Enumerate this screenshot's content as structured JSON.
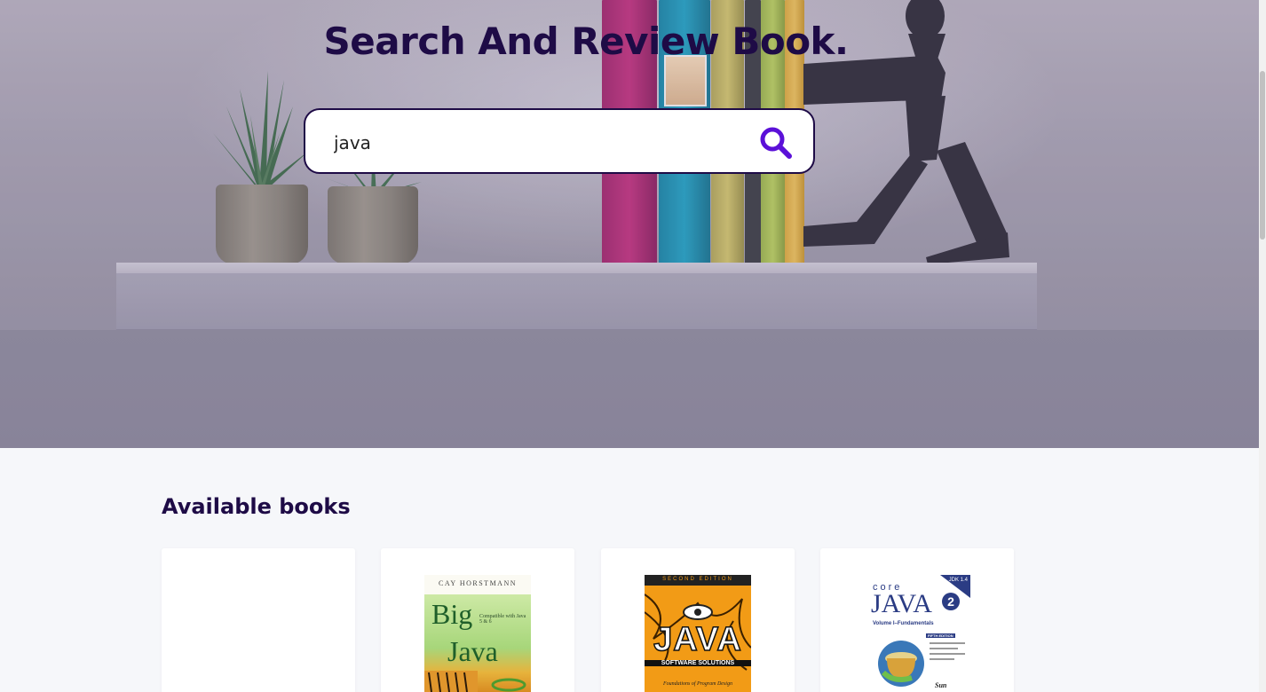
{
  "hero": {
    "title": "Search And Review Book."
  },
  "search": {
    "value": "java",
    "placeholder": "",
    "button_icon": "search-icon",
    "icon_color": "#5b10d8"
  },
  "section": {
    "title": "Available books"
  },
  "books": [
    {
      "cover": "blank"
    },
    {
      "cover_author": "CAY HORSTMANN",
      "cover_title_1": "Big",
      "cover_title_2": "Java",
      "cover_subtitle": "Compatible with Java 5 & 6"
    },
    {
      "cover_top": "SECOND EDITION",
      "cover_title": "JAVA",
      "cover_subtitle": "SOFTWARE SOLUTIONS",
      "cover_tagline": "Foundations of Program Design"
    },
    {
      "cover_word_1": "core",
      "cover_title": "JAVA",
      "cover_number": "2",
      "cover_volume": "Volume I–Fundamentals",
      "cover_badge": "JDK 1.4",
      "cover_edition": "FIFTH EDITION",
      "cover_publisher": "Sun"
    }
  ],
  "colors": {
    "title": "#1e0b46",
    "accent": "#5b10d8",
    "background": "#f6f7fa"
  }
}
